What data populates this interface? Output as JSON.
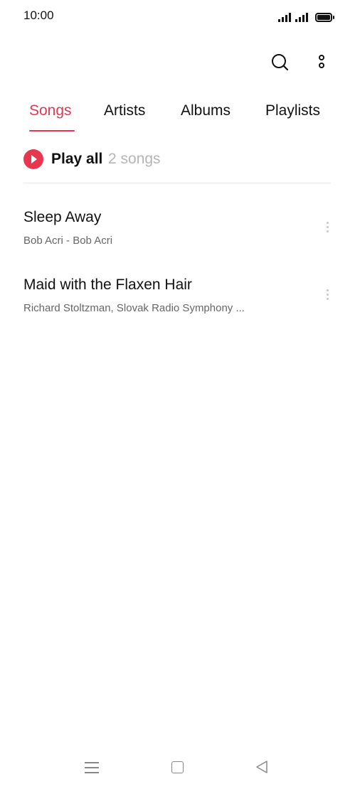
{
  "status_bar": {
    "time": "10:00",
    "icons": [
      "signal-icon",
      "signal-icon",
      "battery-icon"
    ]
  },
  "action_bar": {
    "icons": [
      "search-icon",
      "more-vertical-icon"
    ]
  },
  "tabs": [
    {
      "label": "Songs",
      "active": true
    },
    {
      "label": "Artists",
      "active": false
    },
    {
      "label": "Albums",
      "active": false
    },
    {
      "label": "Playlists",
      "active": false
    }
  ],
  "play_all": {
    "label": "Play all",
    "count": "2 songs"
  },
  "songs": [
    {
      "title": "Sleep Away",
      "artist": "Bob Acri - Bob Acri"
    },
    {
      "title": "Maid with the Flaxen Hair",
      "artist": "Richard Stoltzman, Slovak Radio Symphony ..."
    }
  ],
  "nav_bar": {
    "icons": [
      "menu-icon",
      "home-icon",
      "back-icon"
    ]
  },
  "colors": {
    "accent": "#e8364f",
    "text": "#111111",
    "secondary_text": "#666666",
    "muted_text": "#b5b5b5"
  }
}
